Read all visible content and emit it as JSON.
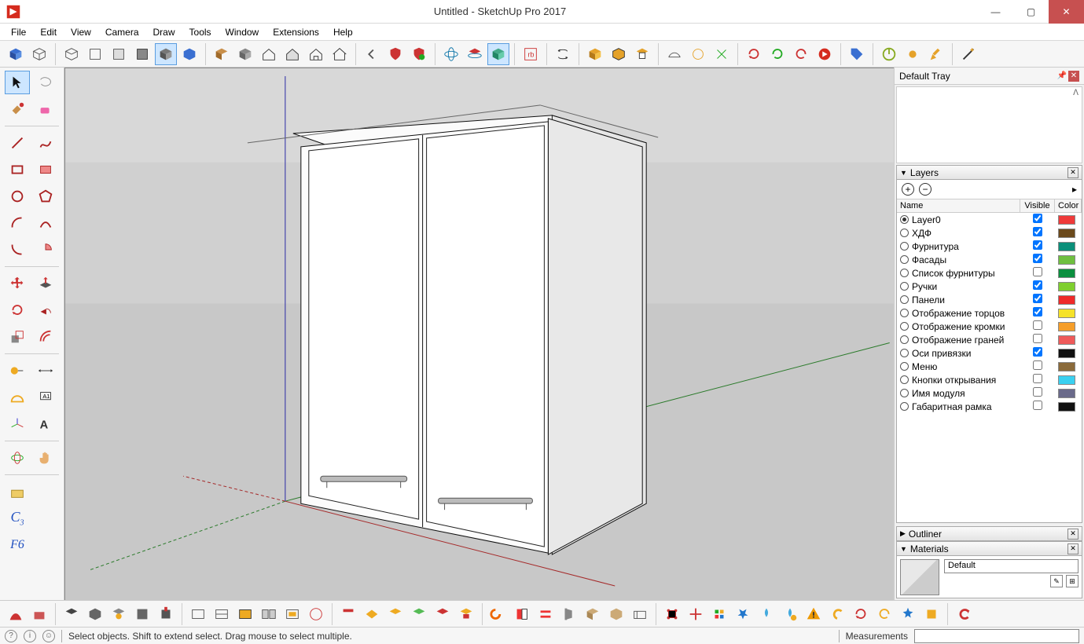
{
  "titlebar": {
    "title": "Untitled - SketchUp Pro 2017"
  },
  "menubar": [
    "File",
    "Edit",
    "View",
    "Camera",
    "Draw",
    "Tools",
    "Window",
    "Extensions",
    "Help"
  ],
  "tray": {
    "title": "Default Tray",
    "panels": {
      "layers": {
        "title": "Layers",
        "columns": {
          "name": "Name",
          "visible": "Visible",
          "color": "Color"
        },
        "items": [
          {
            "name": "Layer0",
            "active": true,
            "visible": true,
            "color": "#ef3a3a"
          },
          {
            "name": "ХДФ",
            "active": false,
            "visible": true,
            "color": "#6b4a1c"
          },
          {
            "name": "Фурнитура",
            "active": false,
            "visible": true,
            "color": "#0b8f7a"
          },
          {
            "name": "Фасады",
            "active": false,
            "visible": true,
            "color": "#6fbf3f"
          },
          {
            "name": "Список фурнитуры",
            "active": false,
            "visible": false,
            "color": "#0b8f3f"
          },
          {
            "name": "Ручки",
            "active": false,
            "visible": true,
            "color": "#7fcf2f"
          },
          {
            "name": "Панели",
            "active": false,
            "visible": true,
            "color": "#ef2a2a"
          },
          {
            "name": "Отображение торцов",
            "active": false,
            "visible": true,
            "color": "#f5e22a"
          },
          {
            "name": "Отображение кромки",
            "active": false,
            "visible": false,
            "color": "#f59e2a"
          },
          {
            "name": "Отображение граней",
            "active": false,
            "visible": false,
            "color": "#ef5a5a"
          },
          {
            "name": "Оси привязки",
            "active": false,
            "visible": true,
            "color": "#111111"
          },
          {
            "name": "Меню",
            "active": false,
            "visible": false,
            "color": "#8a6a3a"
          },
          {
            "name": "Кнопки открывания",
            "active": false,
            "visible": false,
            "color": "#3ad0f0"
          },
          {
            "name": "Имя модуля",
            "active": false,
            "visible": false,
            "color": "#6a6a8a"
          },
          {
            "name": "Габаритная рамка",
            "active": false,
            "visible": false,
            "color": "#111111"
          }
        ]
      },
      "outliner": {
        "title": "Outliner"
      },
      "materials": {
        "title": "Materials",
        "default_name": "Default"
      }
    }
  },
  "status": {
    "hint": "Select objects. Shift to extend select. Drag mouse to select multiple.",
    "measurements_label": "Measurements"
  },
  "left_tooltips_fg": "F6"
}
